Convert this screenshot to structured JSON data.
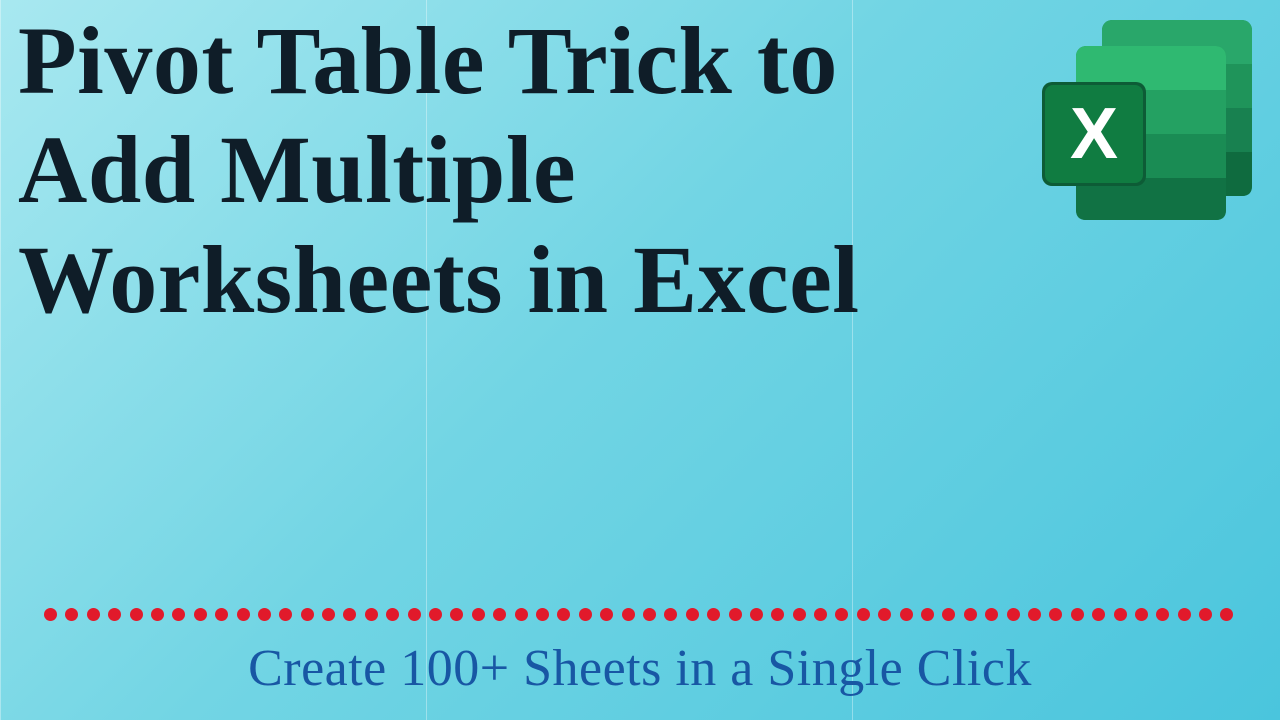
{
  "title": "Pivot Table Trick to Add Multiple Worksheets in Excel",
  "subtitle": "Create 100+ Sheets in a Single Click",
  "colors": {
    "title": "#0f1d28",
    "subtitle": "#1857a4",
    "dots": "#e11a2b",
    "bgFrom": "#a8e8f0",
    "bgTo": "#4ac5dd",
    "excelDark": "#0f6b3f",
    "excelMid": "#1b8a53",
    "excelLight": "#29a76a",
    "excelSquare": "#107C41"
  },
  "dotCount": 56,
  "icon": "excel-icon"
}
